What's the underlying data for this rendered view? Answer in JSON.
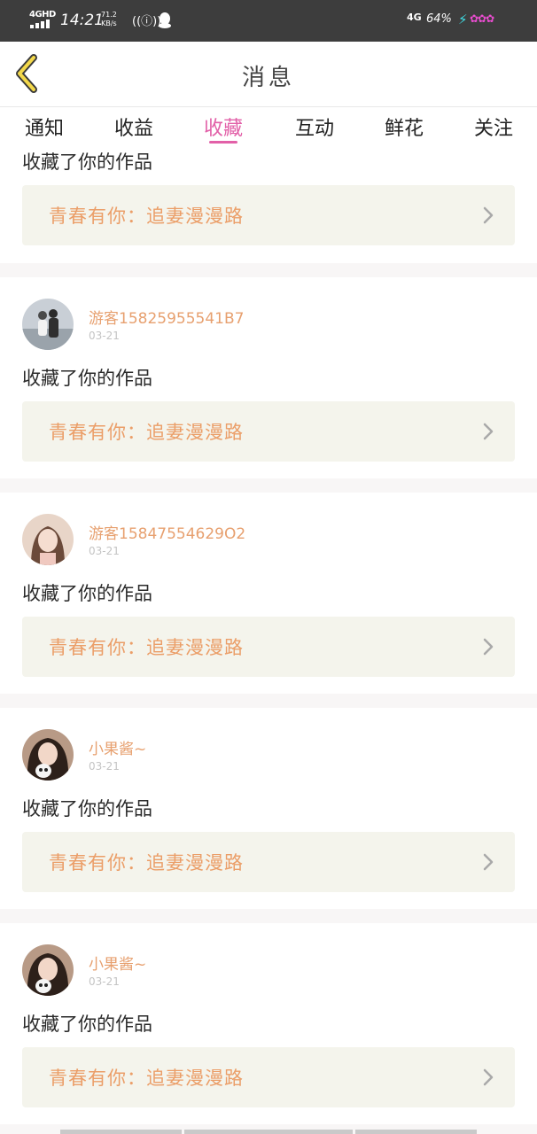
{
  "status_bar": {
    "network": "4GHD",
    "time": "14:21",
    "speed_value": "71.2",
    "speed_unit": "KB/s",
    "network2": "4G",
    "battery": "64%"
  },
  "header": {
    "title": "消息",
    "back_icon": "chevron-left-icon"
  },
  "tabs": [
    {
      "label": "通知",
      "active": false
    },
    {
      "label": "收益",
      "active": false
    },
    {
      "label": "收藏",
      "active": true
    },
    {
      "label": "互动",
      "active": false
    },
    {
      "label": "鲜花",
      "active": false
    },
    {
      "label": "关注",
      "active": false
    }
  ],
  "colors": {
    "accent": "#e260a8",
    "username": "#e7a06f",
    "work_title": "#eb9e68",
    "card_bg": "#f4f4ec"
  },
  "feed": {
    "partial_item": {
      "action": "收藏了你的作品",
      "work_title": "青春有你：追妻漫漫路"
    },
    "items": [
      {
        "username": "游客15825955541B7",
        "date": "03-21",
        "action": "收藏了你的作品",
        "work_title": "青春有你：追妻漫漫路"
      },
      {
        "username": "游客15847554629O2",
        "date": "03-21",
        "action": "收藏了你的作品",
        "work_title": "青春有你：追妻漫漫路"
      },
      {
        "username": "小果酱~",
        "date": "03-21",
        "action": "收藏了你的作品",
        "work_title": "青春有你：追妻漫漫路"
      },
      {
        "username": "小果酱~",
        "date": "03-21",
        "action": "收藏了你的作品",
        "work_title": "青春有你：追妻漫漫路"
      }
    ]
  }
}
